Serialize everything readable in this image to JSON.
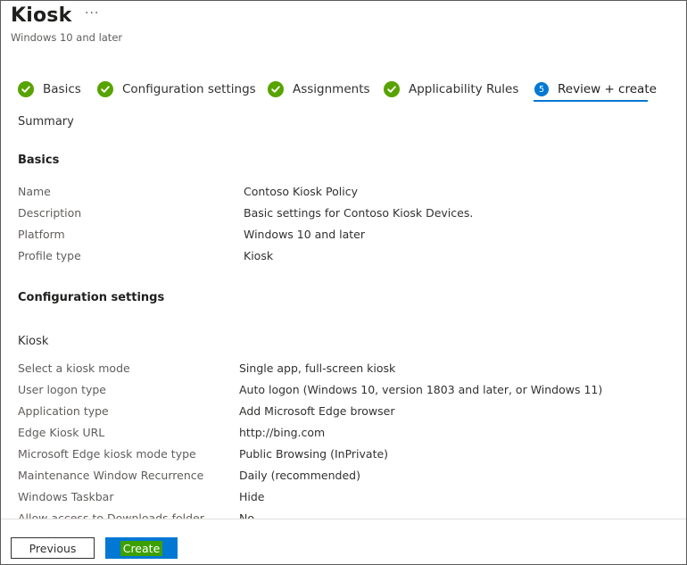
{
  "header": {
    "title": "Kiosk",
    "more_label": "···",
    "subtitle": "Windows 10 and later"
  },
  "steps": [
    {
      "label": "Basics",
      "status": "complete"
    },
    {
      "label": "Configuration settings",
      "status": "complete"
    },
    {
      "label": "Assignments",
      "status": "complete"
    },
    {
      "label": "Applicability Rules",
      "status": "complete"
    },
    {
      "label": "Review + create",
      "status": "active",
      "number": "5"
    }
  ],
  "summary_label": "Summary",
  "basics": {
    "heading": "Basics",
    "rows": [
      {
        "key": "Name",
        "value": "Contoso Kiosk Policy"
      },
      {
        "key": "Description",
        "value": "Basic settings for Contoso Kiosk Devices."
      },
      {
        "key": "Platform",
        "value": "Windows 10 and later"
      },
      {
        "key": "Profile type",
        "value": "Kiosk"
      }
    ]
  },
  "config": {
    "heading": "Configuration settings",
    "subheading": "Kiosk",
    "rows": [
      {
        "key": "Select a kiosk mode",
        "value": "Single app, full-screen kiosk"
      },
      {
        "key": "User logon type",
        "value": "Auto logon (Windows 10, version 1803 and later, or Windows 11)"
      },
      {
        "key": "Application type",
        "value": "Add Microsoft Edge browser"
      },
      {
        "key": "Edge Kiosk URL",
        "value": "http://bing.com"
      },
      {
        "key": "Microsoft Edge kiosk mode type",
        "value": "Public Browsing (InPrivate)"
      },
      {
        "key": "Maintenance Window Recurrence",
        "value": "Daily (recommended)"
      },
      {
        "key": "Windows Taskbar",
        "value": "Hide"
      },
      {
        "key": "Allow access to Downloads folder",
        "value": "No"
      }
    ]
  },
  "footer": {
    "previous_label": "Previous",
    "create_label": "Create"
  },
  "colors": {
    "accent": "#0078d4",
    "success": "#57a300",
    "create_highlight": "#3ca000"
  }
}
